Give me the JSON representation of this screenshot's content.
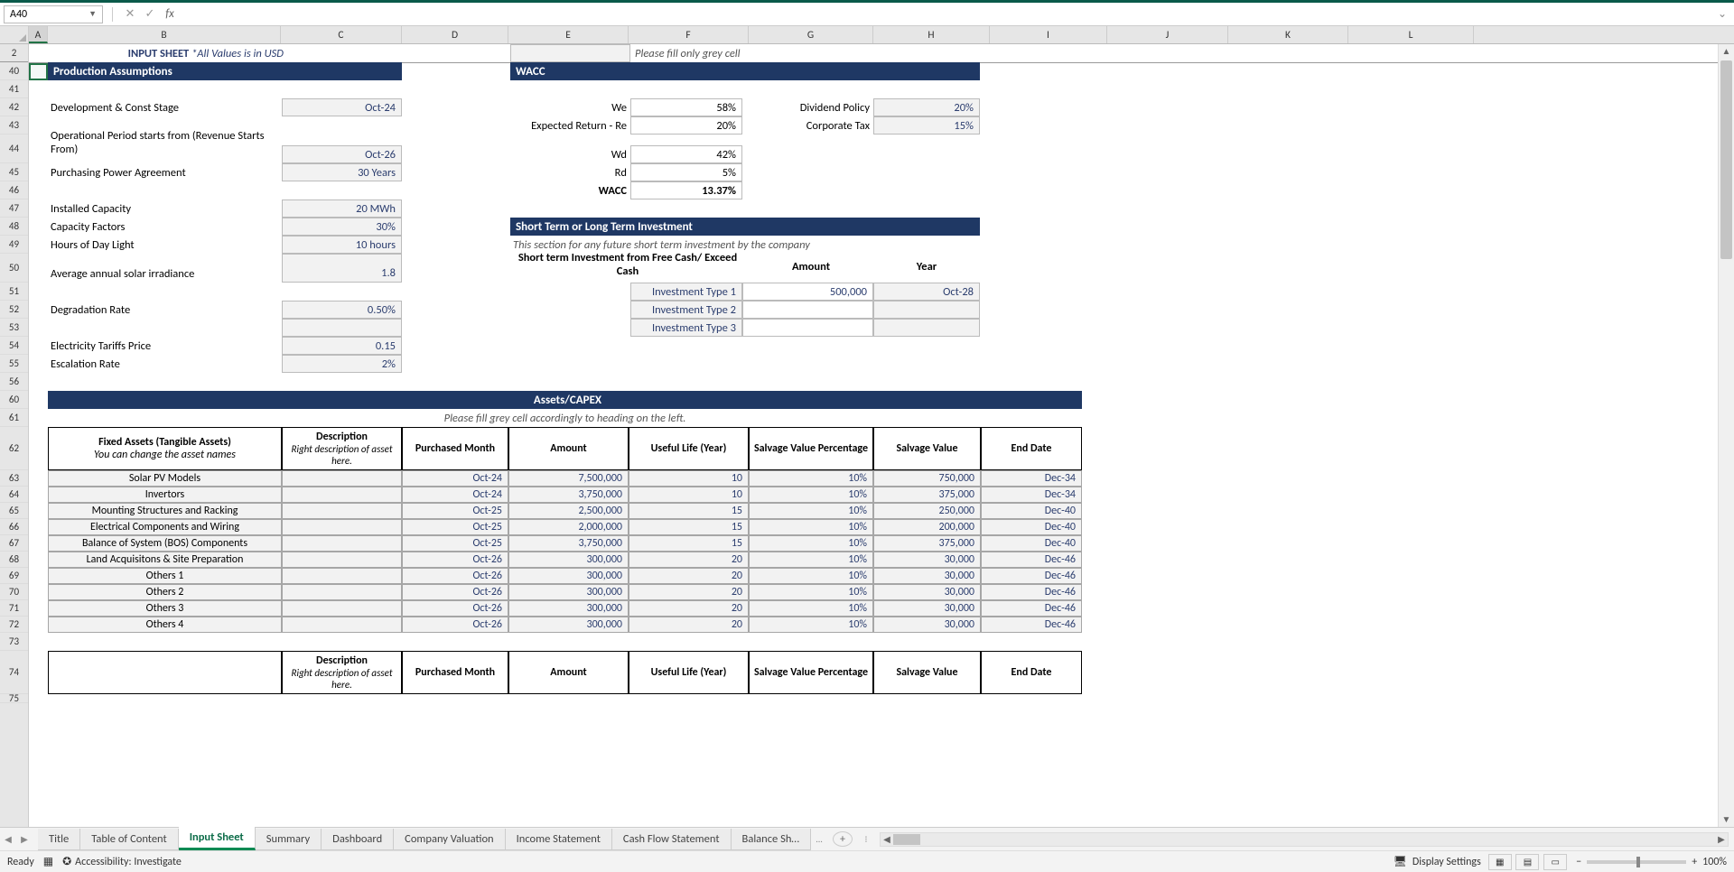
{
  "namebox": "A40",
  "formula": "",
  "cols": [
    "A",
    "B",
    "C",
    "D",
    "E",
    "F",
    "G",
    "H",
    "I",
    "J",
    "K",
    "L"
  ],
  "pinned": {
    "label1": "INPUT SHEET",
    "label2": "*All Values is in USD",
    "hint": "Please fill only grey cell"
  },
  "rows": [
    "2",
    "40",
    "41",
    "42",
    "43",
    "44",
    "45",
    "46",
    "47",
    "48",
    "49",
    "50",
    "51",
    "52",
    "53",
    "54",
    "55",
    "56",
    "60",
    "61",
    "62",
    "63",
    "64",
    "65",
    "66",
    "67",
    "68",
    "69",
    "70",
    "71",
    "72",
    "73",
    "74",
    "75"
  ],
  "sections": {
    "prod": "Production Assumptions",
    "wacc": "WACC",
    "st": "Short Term or Long Term Investment",
    "capex": "Assets/CAPEX"
  },
  "prod": {
    "dev_label": "Development & Const Stage",
    "dev_val": "Oct-24",
    "op_label": "Operational Period starts from (Revenue Starts From)",
    "op_val": "Oct-26",
    "ppa_label": "Purchasing Power Agreement",
    "ppa_val": "30 Years",
    "cap_label": "Installed Capacity",
    "cap_val": "20 MWh",
    "cf_label": "Capacity Factors",
    "cf_val": "30%",
    "hd_label": "Hours of Day Light",
    "hd_val": "10 hours",
    "irr_label": "Average annual solar irradiance",
    "irr_val": "1.8",
    "deg_label": "Degradation Rate",
    "deg_val": "0.50%",
    "tar_label": "Electricity Tariffs Price",
    "tar_val": "0.15",
    "esc_label": "Escalation Rate",
    "esc_val": "2%"
  },
  "wacc": {
    "we_l": "We",
    "we_v": "58%",
    "re_l": "Expected Return - Re",
    "re_v": "20%",
    "wd_l": "Wd",
    "wd_v": "42%",
    "rd_l": "Rd",
    "rd_v": "5%",
    "wacc_l": "WACC",
    "wacc_v": "13.37%",
    "div_l": "Dividend Policy",
    "div_v": "20%",
    "tax_l": "Corporate Tax",
    "tax_v": "15%"
  },
  "st": {
    "note": "This section for any future short term investment by the company",
    "hdr1": "Short term Investment from Free Cash/ Exceed Cash",
    "hdr_amt": "Amount",
    "hdr_yr": "Year",
    "rows": [
      {
        "t": "Investment Type 1",
        "a": "500,000",
        "y": "Oct-28"
      },
      {
        "t": "Investment Type 2",
        "a": "",
        "y": ""
      },
      {
        "t": "Investment Type 3",
        "a": "",
        "y": ""
      }
    ]
  },
  "capex": {
    "note": "Please fill grey cell accordingly to heading on the left.",
    "hdrs": {
      "fa": "Fixed Assets (Tangible Assets)",
      "fa_sub": "You can change the asset names",
      "desc": "Description",
      "desc_sub": "Right description of asset here.",
      "pm": "Purchased  Month",
      "amt": "Amount",
      "ul": "Useful Life (Year)",
      "svp": "Salvage Value Percentage",
      "sv": "Salvage Value",
      "ed": "End Date"
    },
    "rows": [
      {
        "n": "Solar PV Models",
        "pm": "Oct-24",
        "a": "7,500,000",
        "ul": "10",
        "svp": "10%",
        "sv": "750,000",
        "ed": "Dec-34"
      },
      {
        "n": "Invertors",
        "pm": "Oct-24",
        "a": "3,750,000",
        "ul": "10",
        "svp": "10%",
        "sv": "375,000",
        "ed": "Dec-34"
      },
      {
        "n": "Mounting Structures and Racking",
        "pm": "Oct-25",
        "a": "2,500,000",
        "ul": "15",
        "svp": "10%",
        "sv": "250,000",
        "ed": "Dec-40"
      },
      {
        "n": "Electrical Components and Wiring",
        "pm": "Oct-25",
        "a": "2,000,000",
        "ul": "15",
        "svp": "10%",
        "sv": "200,000",
        "ed": "Dec-40"
      },
      {
        "n": "Balance of System (BOS) Components",
        "pm": "Oct-25",
        "a": "3,750,000",
        "ul": "15",
        "svp": "10%",
        "sv": "375,000",
        "ed": "Dec-40"
      },
      {
        "n": "Land Acquisitons & Site Preparation",
        "pm": "Oct-26",
        "a": "300,000",
        "ul": "20",
        "svp": "10%",
        "sv": "30,000",
        "ed": "Dec-46"
      },
      {
        "n": "Others 1",
        "pm": "Oct-26",
        "a": "300,000",
        "ul": "20",
        "svp": "10%",
        "sv": "30,000",
        "ed": "Dec-46"
      },
      {
        "n": "Others 2",
        "pm": "Oct-26",
        "a": "300,000",
        "ul": "20",
        "svp": "10%",
        "sv": "30,000",
        "ed": "Dec-46"
      },
      {
        "n": "Others 3",
        "pm": "Oct-26",
        "a": "300,000",
        "ul": "20",
        "svp": "10%",
        "sv": "30,000",
        "ed": "Dec-46"
      },
      {
        "n": "Others 4",
        "pm": "Oct-26",
        "a": "300,000",
        "ul": "20",
        "svp": "10%",
        "sv": "30,000",
        "ed": "Dec-46"
      }
    ]
  },
  "tabs": [
    "Title",
    "Table of Content",
    "Input Sheet",
    "Summary",
    "Dashboard",
    "Company Valuation",
    "Income Statement",
    "Cash Flow Statement",
    "Balance Sh…"
  ],
  "active_tab": 2,
  "status": {
    "ready": "Ready",
    "acc": "Accessibility: Investigate",
    "disp": "Display Settings",
    "zoom": "100%"
  }
}
